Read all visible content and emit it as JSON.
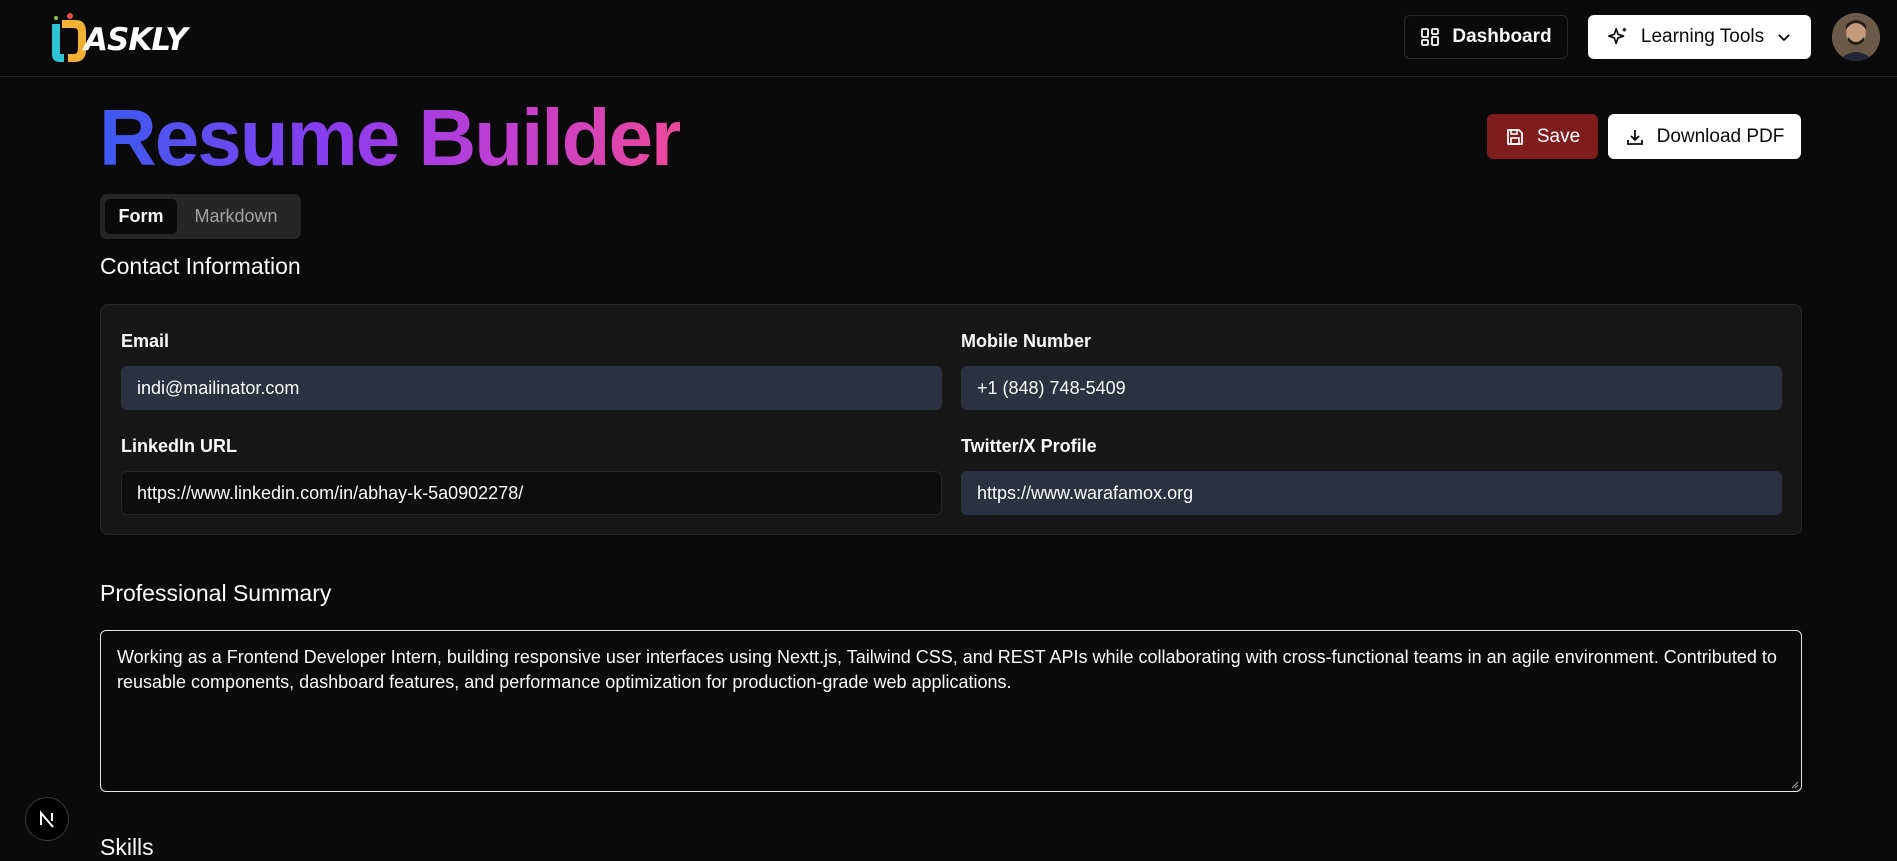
{
  "header": {
    "logo_text": "ASKLY",
    "dashboard_label": "Dashboard",
    "learning_tools_label": "Learning Tools"
  },
  "page": {
    "title": "Resume Builder",
    "save_label": "Save",
    "download_label": "Download PDF",
    "tabs": [
      {
        "label": "Form",
        "active": true
      },
      {
        "label": "Markdown",
        "active": false
      }
    ]
  },
  "contact": {
    "heading": "Contact Information",
    "email_label": "Email",
    "email_value": "indi@mailinator.com",
    "mobile_label": "Mobile Number",
    "mobile_value": "+1 (848) 748-5409",
    "linkedin_label": "LinkedIn URL",
    "linkedin_value": "https://www.linkedin.com/in/abhay-k-5a0902278/",
    "twitter_label": "Twitter/X Profile",
    "twitter_value": "https://www.warafamox.org"
  },
  "summary": {
    "heading": "Professional Summary",
    "text": "Working as a Frontend Developer Intern, building responsive user interfaces using Nextt.js, Tailwind CSS, and REST APIs while collaborating with cross-functional teams in an agile environment. Contributed to reusable components, dashboard features, and performance optimization for production-grade web applications."
  },
  "skills": {
    "heading": "Skills"
  },
  "colors": {
    "background": "#0a0a0a",
    "save_button": "#7f1d1d",
    "input_filled": "#2b3140",
    "title_gradient_start": "#3b5bf0",
    "title_gradient_end": "#ec4899"
  }
}
